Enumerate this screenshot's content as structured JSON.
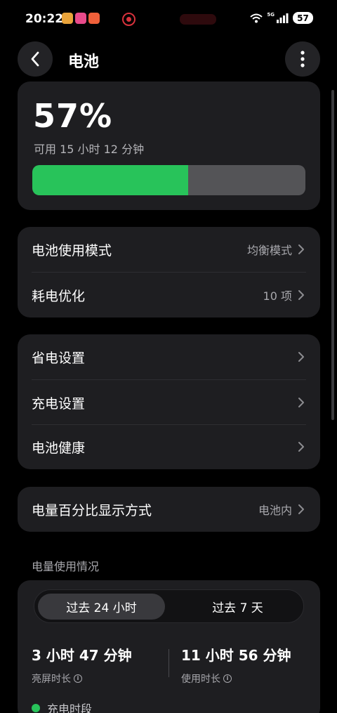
{
  "status_bar": {
    "time": "20:22",
    "network": "5G",
    "battery_level": "57",
    "app_icon_colors": [
      "#e8a33a",
      "#e84a8a",
      "#f0603a"
    ]
  },
  "header": {
    "title": "电池"
  },
  "battery": {
    "percent_text": "57%",
    "remaining": "可用 15 小时 12 分钟",
    "level_percent": 57,
    "fill_color": "#28c35a"
  },
  "settings_group_1": [
    {
      "label": "电池使用模式",
      "value": "均衡模式"
    },
    {
      "label": "耗电优化",
      "value": "10 项"
    }
  ],
  "settings_group_2": [
    {
      "label": "省电设置"
    },
    {
      "label": "充电设置"
    },
    {
      "label": "电池健康"
    }
  ],
  "settings_group_3": [
    {
      "label": "电量百分比显示方式",
      "value": "电池内"
    }
  ],
  "usage": {
    "section_title": "电量使用情况",
    "tabs": [
      {
        "label": "过去 24 小时",
        "active": true
      },
      {
        "label": "过去 7 天",
        "active": false
      }
    ],
    "screen_on": {
      "value": "3 小时 47 分钟",
      "label": "亮屏时长"
    },
    "usage_time": {
      "value": "11 小时 56 分钟",
      "label": "使用时长"
    },
    "legend_charging": "充电时段"
  },
  "icons": {
    "info_glyph": "i"
  }
}
